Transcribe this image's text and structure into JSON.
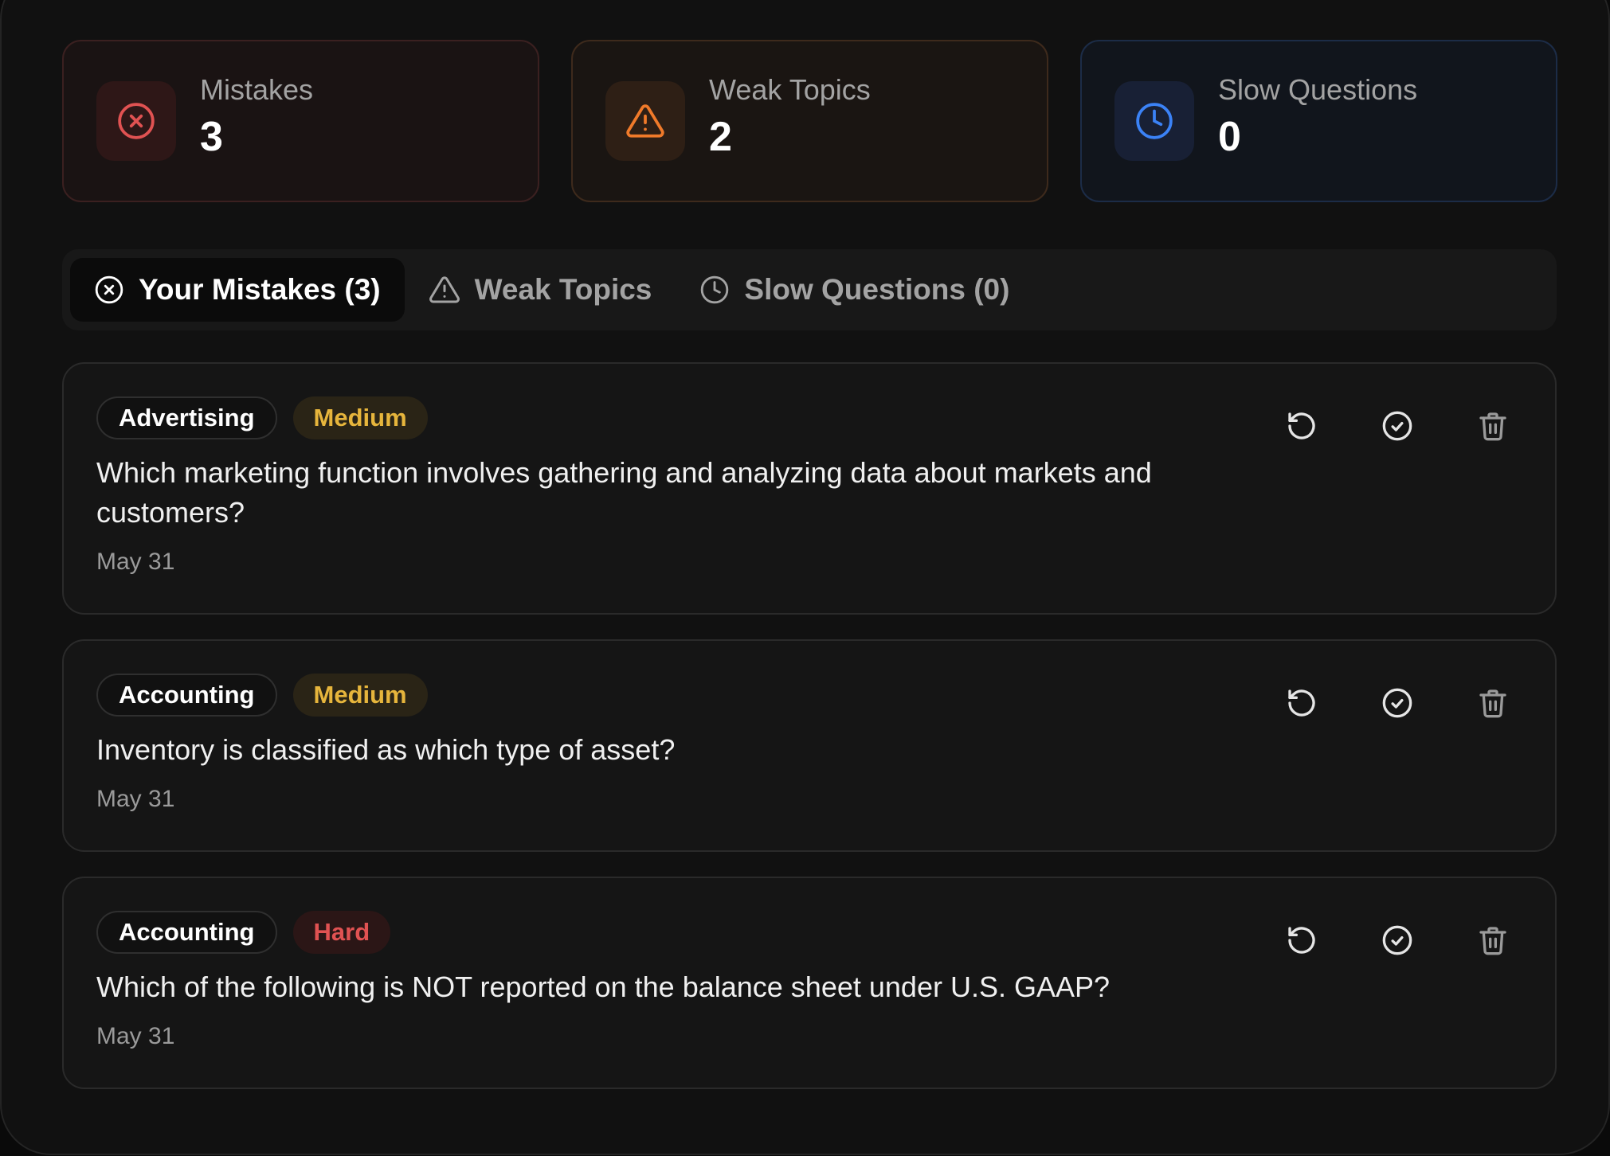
{
  "stats": [
    {
      "label": "Mistakes",
      "value": "3",
      "icon": "x-circle-icon",
      "color": "#e05252"
    },
    {
      "label": "Weak Topics",
      "value": "2",
      "icon": "alert-triangle-icon",
      "color": "#f07a2a"
    },
    {
      "label": "Slow Questions",
      "value": "0",
      "icon": "clock-icon",
      "color": "#3b82f6"
    }
  ],
  "tabs": [
    {
      "label": "Your Mistakes (3)",
      "icon": "x-circle-icon",
      "active": true
    },
    {
      "label": "Weak Topics",
      "icon": "alert-triangle-icon",
      "active": false
    },
    {
      "label": "Slow Questions (0)",
      "icon": "clock-icon",
      "active": false
    }
  ],
  "cards": [
    {
      "topic": "Advertising",
      "difficulty": "Medium",
      "question": "Which marketing function involves gathering and analyzing data about markets and customers?",
      "date": "May 31"
    },
    {
      "topic": "Accounting",
      "difficulty": "Medium",
      "question": "Inventory is classified as which type of asset?",
      "date": "May 31"
    },
    {
      "topic": "Accounting",
      "difficulty": "Hard",
      "question": "Which of the following is NOT reported on the balance sheet under U.S. GAAP?",
      "date": "May 31"
    }
  ],
  "action_icons": [
    "retry-icon",
    "check-circle-icon",
    "trash-icon"
  ]
}
